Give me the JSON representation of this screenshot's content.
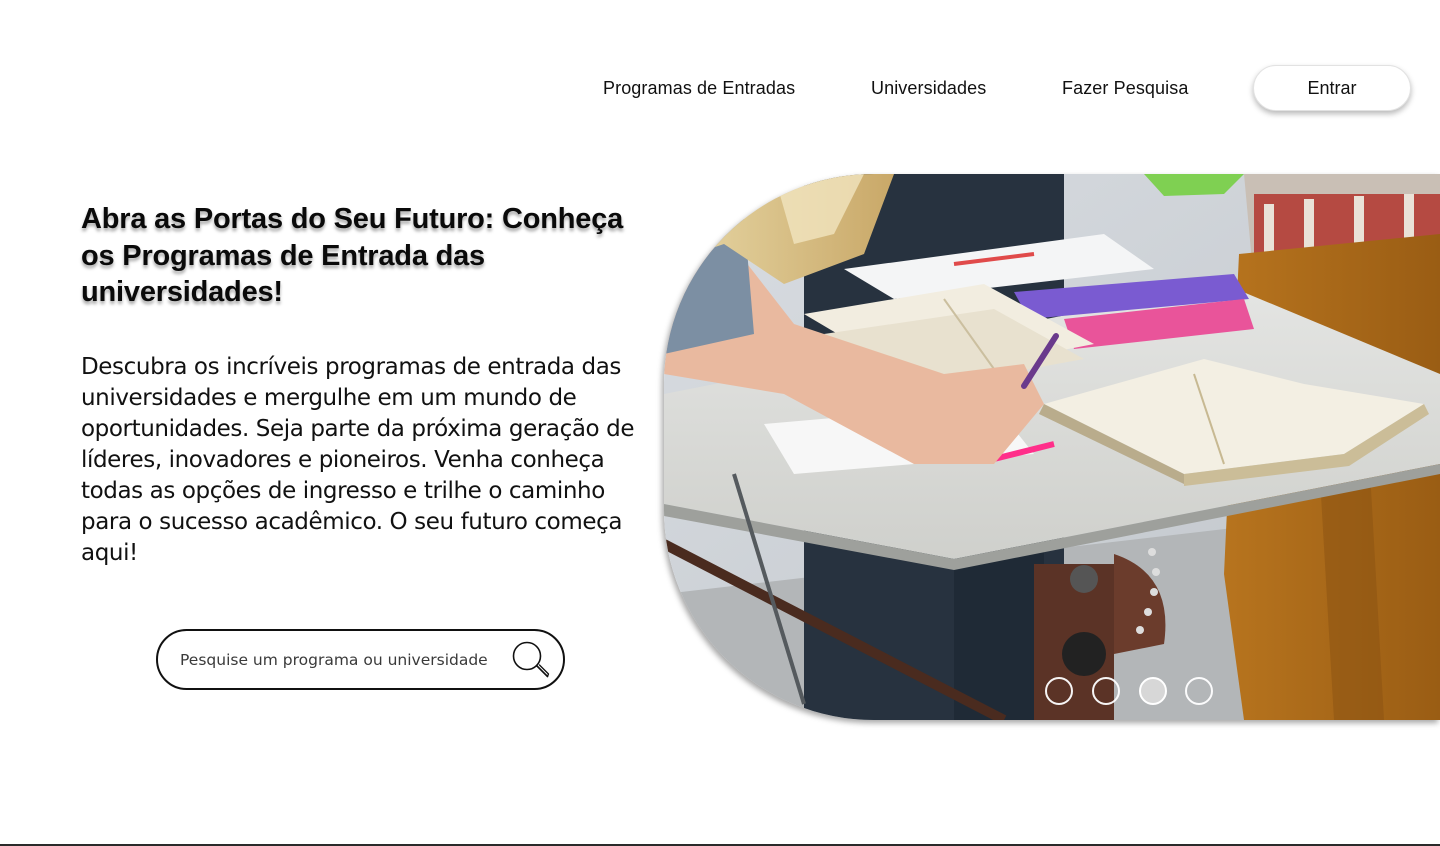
{
  "nav": {
    "items": [
      {
        "label": "Programas de Entradas"
      },
      {
        "label": "Universidades"
      },
      {
        "label": "Fazer Pesquisa"
      }
    ],
    "login_label": "Entrar"
  },
  "hero": {
    "title": "Abra as Portas do Seu Futuro: Conheça os Programas de Entrada das universidades!",
    "description": "Descubra os incríveis programas de entrada das universidades e mergulhe em um mundo de oportunidades. Seja parte da próxima geração de líderes, inovadores e pioneiros. Venha conheça todas as opções de ingresso e trilhe o caminho para o sucesso acadêmico. O seu futuro começa aqui!"
  },
  "search": {
    "placeholder": "Pesquise um programa ou universidade",
    "value": "",
    "icon": "magnifier-icon"
  },
  "carousel": {
    "slide_count": 4,
    "active_index": 2
  }
}
